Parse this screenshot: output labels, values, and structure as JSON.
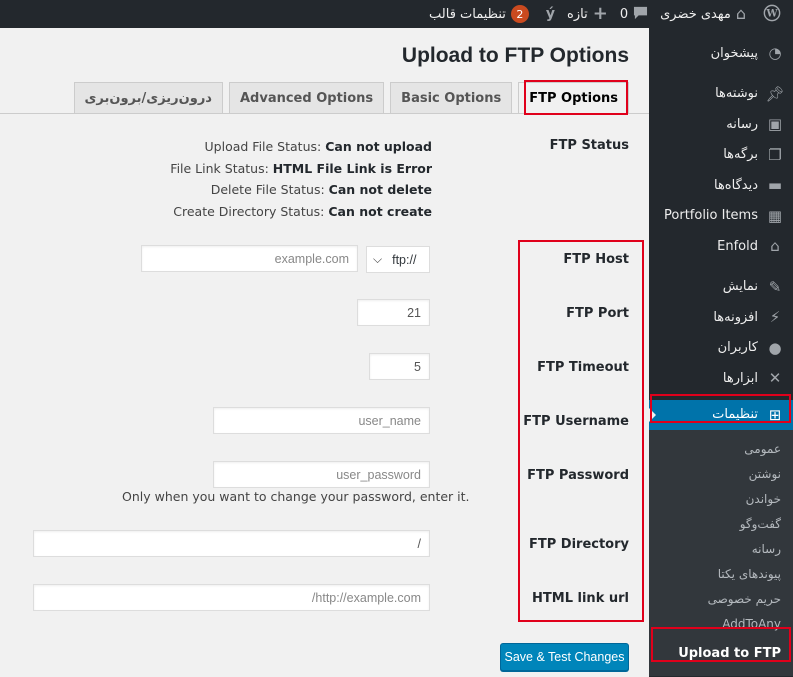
{
  "adminbar": {
    "site_name": "مهدی خضری",
    "comments_count": "0",
    "new_label": "تازه",
    "updates_count": "2",
    "theme_settings_label": "تنظیمات قالب",
    "wp_logo_icon": "wordpress-icon",
    "home_icon": "home-icon",
    "comment_icon": "comment-icon",
    "plus_icon": "plus-icon",
    "yoast_icon": "yoast-icon"
  },
  "sidebar": {
    "items": [
      {
        "label": "پیشخوان",
        "icon": "dashboard-icon"
      },
      {
        "label": "نوشته‌ها",
        "icon": "pin-icon"
      },
      {
        "label": "رسانه",
        "icon": "media-icon"
      },
      {
        "label": "برگه‌ها",
        "icon": "pages-icon"
      },
      {
        "label": "دیدگاه‌ها",
        "icon": "comments-icon"
      },
      {
        "label": "Portfolio Items",
        "icon": "portfolio-icon"
      },
      {
        "label": "Enfold",
        "icon": "enfold-icon"
      },
      {
        "label": "نمایش",
        "icon": "appearance-icon"
      },
      {
        "label": "افزونه‌ها",
        "icon": "plugins-icon"
      },
      {
        "label": "کاربران",
        "icon": "users-icon"
      },
      {
        "label": "ابزارها",
        "icon": "tools-icon"
      },
      {
        "label": "تنظیمات",
        "icon": "settings-icon"
      }
    ],
    "submenu": [
      "عمومی",
      "نوشتن",
      "خواندن",
      "گفت‌وگو",
      "رسانه",
      "پیوندهای یکتا",
      "حریم خصوصی",
      "AddToAny",
      "Upload to FTP"
    ]
  },
  "page": {
    "title": "Upload to FTP Options",
    "tabs": [
      "FTP Options",
      "Basic Options",
      "Advanced Options",
      "درون‌ریزی/برون‌بری"
    ],
    "active_tab": "FTP Options"
  },
  "status": {
    "label": "FTP Status",
    "lines": [
      {
        "name": "Upload File Status:",
        "value": "Can not upload"
      },
      {
        "name": "File Link Status:",
        "value": "HTML File Link is Error"
      },
      {
        "name": "Delete File Status:",
        "value": "Can not delete"
      },
      {
        "name": "Create Directory Status:",
        "value": "Can not create"
      }
    ]
  },
  "fields": {
    "host": {
      "label": "FTP Host",
      "protocol": "ftp://",
      "placeholder": "example.com"
    },
    "port": {
      "label": "FTP Port",
      "value": "21"
    },
    "timeout": {
      "label": "FTP Timeout",
      "value": "5"
    },
    "username": {
      "label": "FTP Username",
      "placeholder": "user_name"
    },
    "password": {
      "label": "FTP Password",
      "placeholder": "user_password",
      "hint": "Only when you want to change your password, enter it."
    },
    "directory": {
      "label": "FTP Directory",
      "value": "/"
    },
    "html_link": {
      "label": "HTML link url",
      "placeholder": "http://example.com/"
    }
  },
  "save_button": "Save & Test Changes",
  "colors": {
    "adminbar": "#23282d",
    "sidebar": "#23282d",
    "active_menu": "#0073aa",
    "primary_button": "#0085ba",
    "highlight": "#e0001b",
    "badge": "#ca4a1f"
  }
}
